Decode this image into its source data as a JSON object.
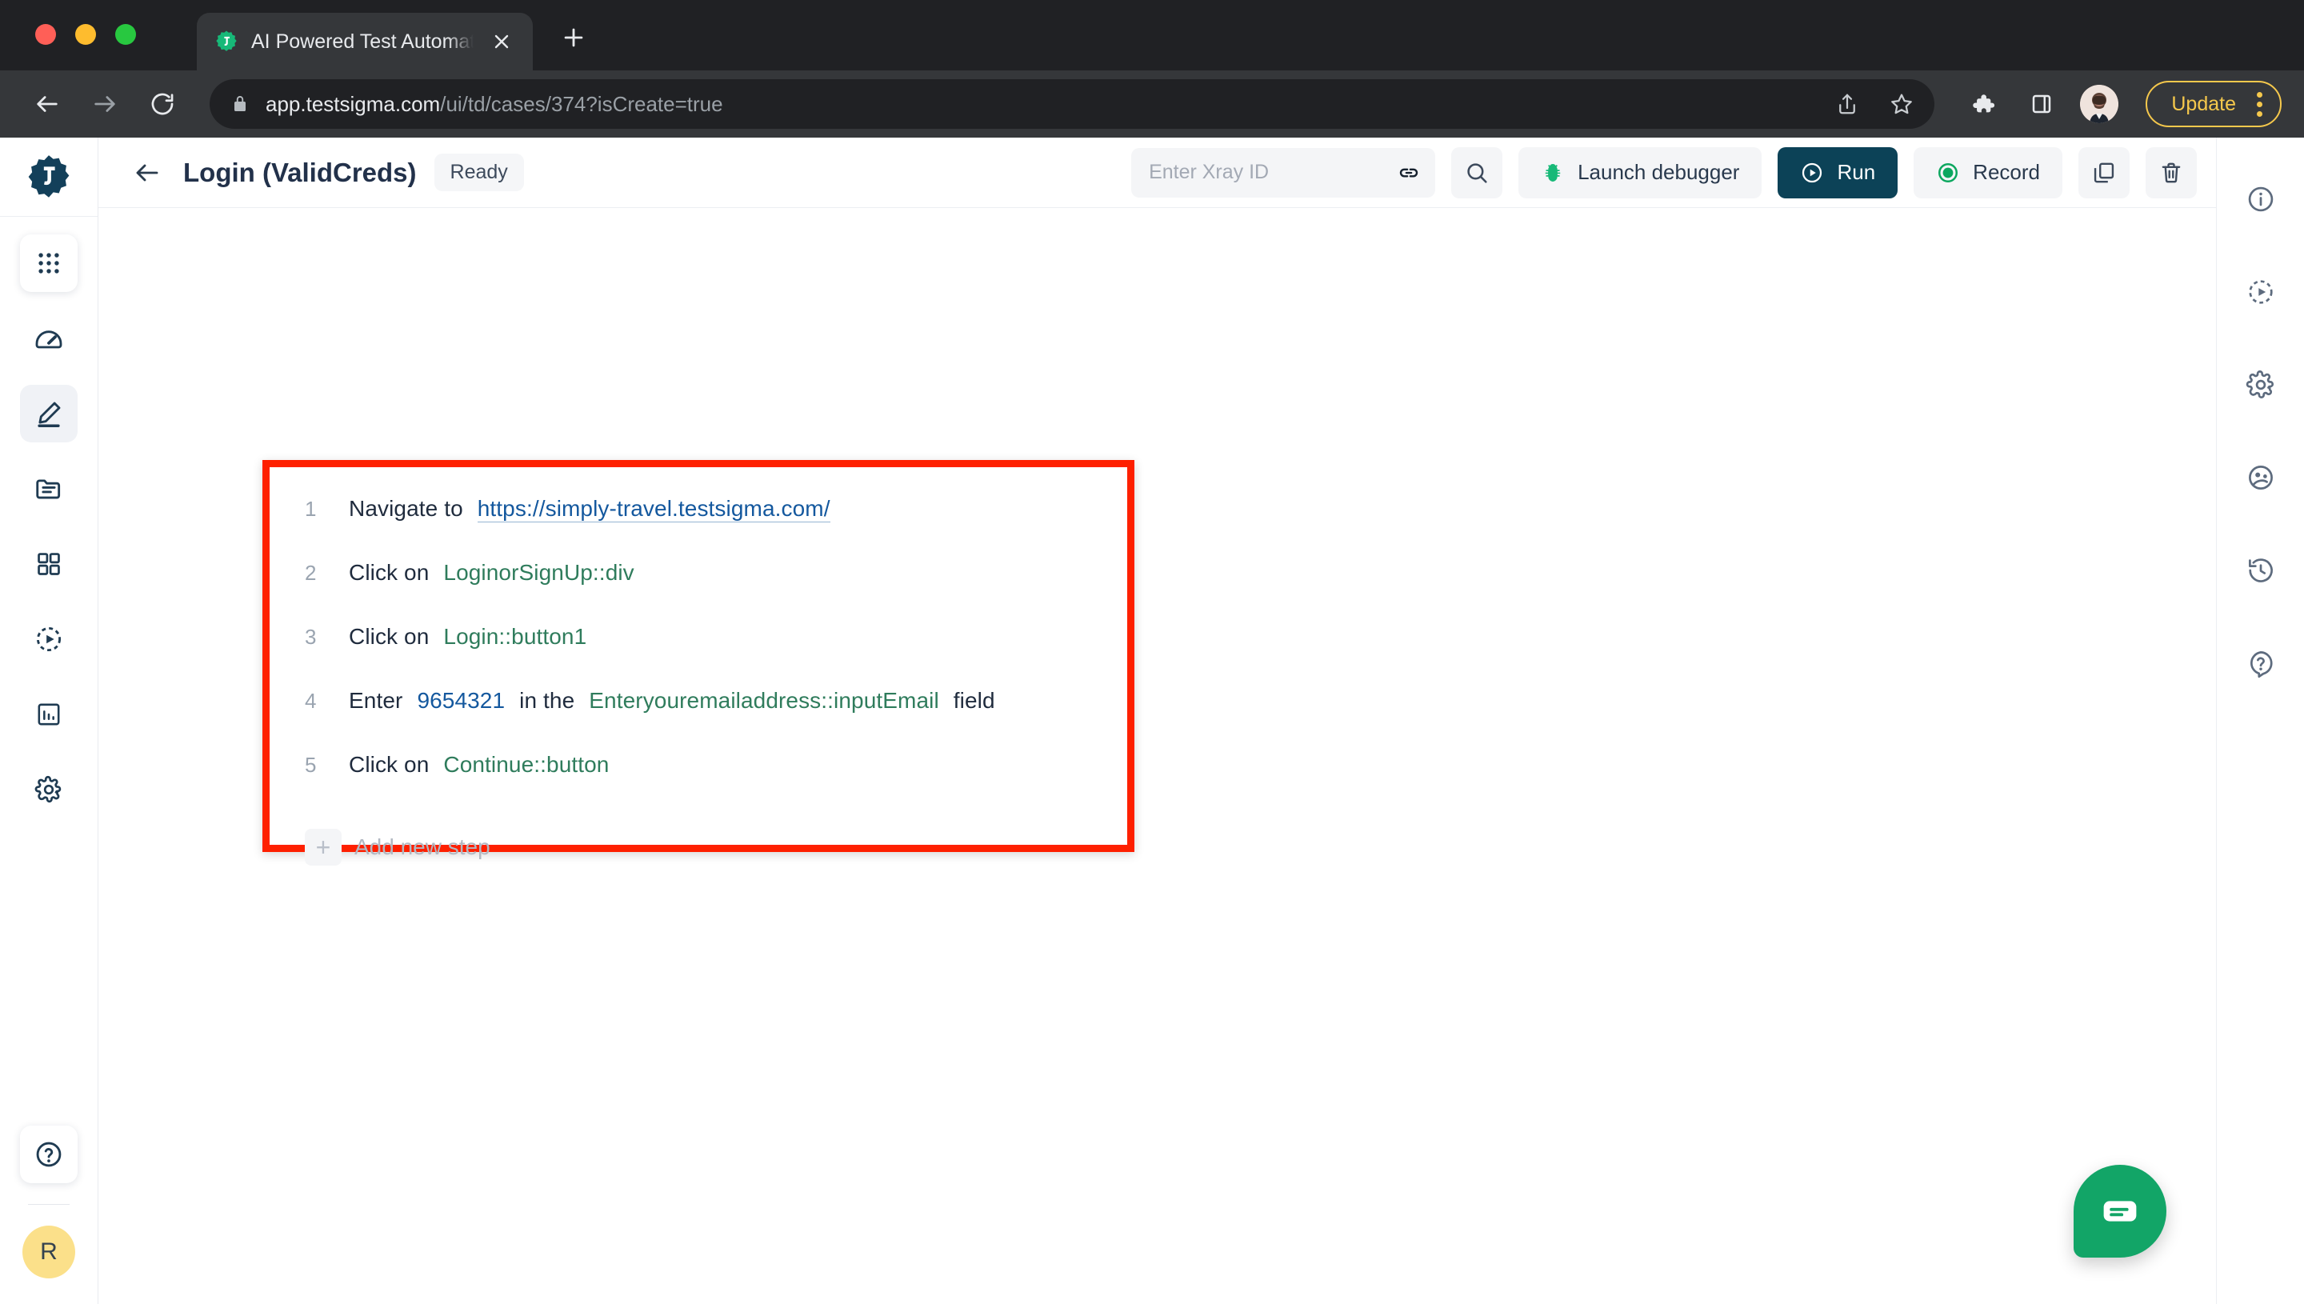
{
  "browser": {
    "tab": {
      "title": "AI Powered Test Automation Pl",
      "favicon": "testsigma-favicon-icon",
      "close": "close-icon"
    },
    "new_tab_label": "+",
    "nav": {
      "back": "back-arrow-icon",
      "forward": "forward-arrow-icon",
      "reload": "reload-icon"
    },
    "omnibox": {
      "lock": "lock-icon",
      "url_host": "app.testsigma.com",
      "url_path": "/ui/td/cases/374?isCreate=true",
      "share": "share-icon",
      "bookmark": "star-icon"
    },
    "toolbar": {
      "extensions": "puzzle-piece-icon",
      "sidepanel": "side-panel-icon",
      "profile": "profile-avatar",
      "update_label": "Update",
      "menu": "three-dot-menu-icon"
    },
    "window_controls": [
      "close",
      "minimize",
      "maximize"
    ]
  },
  "left_rail": {
    "logo": "testsigma-logo",
    "items": [
      {
        "name": "apps-grid",
        "icon": "nine-dot-grid-icon",
        "state": "boxed"
      },
      {
        "name": "dashboard",
        "icon": "speedometer-icon",
        "state": "default"
      },
      {
        "name": "test-development",
        "icon": "pencil-edit-icon",
        "state": "active"
      },
      {
        "name": "test-data",
        "icon": "folder-icon",
        "state": "default"
      },
      {
        "name": "elements",
        "icon": "four-square-grid-icon",
        "state": "default"
      },
      {
        "name": "test-runs",
        "icon": "dashed-play-circle-icon",
        "state": "default"
      },
      {
        "name": "reports",
        "icon": "bar-chart-icon",
        "state": "default"
      },
      {
        "name": "settings",
        "icon": "gear-icon",
        "state": "default"
      }
    ],
    "help_icon": "question-circle-icon",
    "avatar_initial": "R"
  },
  "header": {
    "back_icon": "back-arrow-icon",
    "title": "Login (ValidCreds)",
    "status": "Ready",
    "xray": {
      "placeholder": "Enter Xray ID",
      "value": "",
      "link_icon": "link-icon"
    },
    "search_icon": "search-icon",
    "launch_debugger": {
      "label": "Launch debugger",
      "icon": "bug-icon"
    },
    "run": {
      "label": "Run",
      "icon": "play-circle-icon"
    },
    "record": {
      "label": "Record",
      "icon": "record-circle-icon"
    },
    "copy_icon": "copy-icon",
    "delete_icon": "trash-icon"
  },
  "steps": {
    "annotation_color": "#fe2000",
    "list": [
      {
        "num": "1",
        "parts": [
          {
            "text": "Navigate to",
            "type": "plain"
          },
          {
            "text": "https://simply-travel.testsigma.com/",
            "type": "link"
          }
        ]
      },
      {
        "num": "2",
        "parts": [
          {
            "text": "Click on",
            "type": "plain"
          },
          {
            "text": "LoginorSignUp::div",
            "type": "green"
          }
        ]
      },
      {
        "num": "3",
        "parts": [
          {
            "text": "Click on",
            "type": "plain"
          },
          {
            "text": "Login::button1",
            "type": "green"
          }
        ]
      },
      {
        "num": "4",
        "parts": [
          {
            "text": "Enter",
            "type": "plain"
          },
          {
            "text": "9654321",
            "type": "blue"
          },
          {
            "text": "in the",
            "type": "plain"
          },
          {
            "text": "Enteryouremailaddress::inputEmail",
            "type": "green"
          },
          {
            "text": "field",
            "type": "plain"
          }
        ]
      },
      {
        "num": "5",
        "parts": [
          {
            "text": "Click on",
            "type": "plain"
          },
          {
            "text": "Continue::button",
            "type": "green"
          }
        ]
      }
    ],
    "add_new": {
      "plus": "+",
      "label": "Add new step"
    }
  },
  "right_rail": {
    "items": [
      {
        "name": "details",
        "icon": "info-circle-icon"
      },
      {
        "name": "test-runs",
        "icon": "dashed-play-circle-icon"
      },
      {
        "name": "settings",
        "icon": "gear-icon"
      },
      {
        "name": "comments",
        "icon": "comment-face-icon"
      },
      {
        "name": "history",
        "icon": "history-clock-icon"
      },
      {
        "name": "help",
        "icon": "question-bubble-icon"
      }
    ]
  },
  "chat": {
    "icon": "chat-bubble-icon",
    "color": "#12a567"
  },
  "colors": {
    "accent_dark": "#0c4257",
    "green": "#2f7c5c",
    "blue": "#14589e",
    "annotation_red": "#fe2000",
    "update_yellow": "#f5c84c"
  }
}
